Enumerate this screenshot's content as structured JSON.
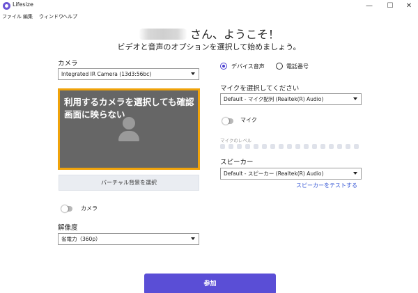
{
  "window": {
    "app_title": "Lifesize",
    "minimize_glyph": "—",
    "maximize_glyph": "☐",
    "close_glyph": "✕"
  },
  "menu": [
    "ファイル",
    "編集",
    "ウィンドウ",
    "ヘルプ"
  ],
  "greeting": {
    "name": "kitagaki",
    "suffix": "さん、ようこそ！",
    "subtitle": "ビデオと音声のオプションを選択して始めましょう。"
  },
  "camera": {
    "label": "カメラ",
    "selected": "Integrated IR Camera (13d3:56bc)",
    "preview_message": "利用するカメラを選択しても確認画面に映らない",
    "virtual_bg_button": "バーチャル背景を選択",
    "toggle_label": "カメラ",
    "toggle_on": false
  },
  "resolution": {
    "label": "解像度",
    "selected": "省電力（360p）"
  },
  "audio": {
    "option_device": "デバイス音声",
    "option_phone": "電話番号",
    "selected_option": "デバイス音声",
    "mic_label": "マイクを選択してください",
    "mic_selected": "Default - マイク配列 (Realtek(R) Audio)",
    "mic_toggle_label": "マイク",
    "mic_toggle_on": false,
    "mic_level_label": "マイクのレベル",
    "speaker_label": "スピーカー",
    "speaker_selected": "Default - スピーカー (Realtek(R) Audio)",
    "test_speaker_link": "スピーカーをテストする"
  },
  "join_button": "参加",
  "colors": {
    "accent": "#5a4ed6",
    "preview_border": "#f0a30a",
    "link": "#3b5bd6"
  }
}
